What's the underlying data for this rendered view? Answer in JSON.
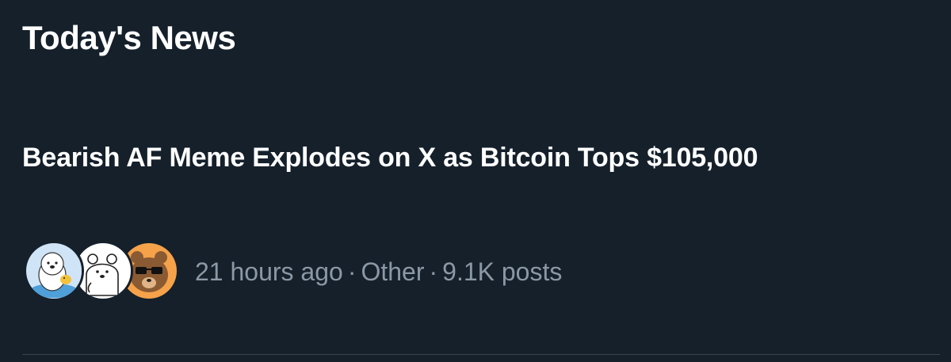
{
  "section": {
    "title": "Today's News"
  },
  "news_item": {
    "headline": "Bearish AF Meme Explodes on X as Bitcoin Tops $105,000",
    "time": "21 hours ago",
    "category": "Other",
    "posts": "9.1K posts",
    "separator": "·",
    "avatars": [
      {
        "icon": "seal-character-avatar-icon"
      },
      {
        "icon": "white-bear-avatar-icon"
      },
      {
        "icon": "bear-with-sunglasses-avatar-icon"
      }
    ]
  },
  "colors": {
    "background": "#15202b",
    "text_primary": "#ffffff",
    "text_secondary": "#8b98a5",
    "divider": "#38444d"
  }
}
